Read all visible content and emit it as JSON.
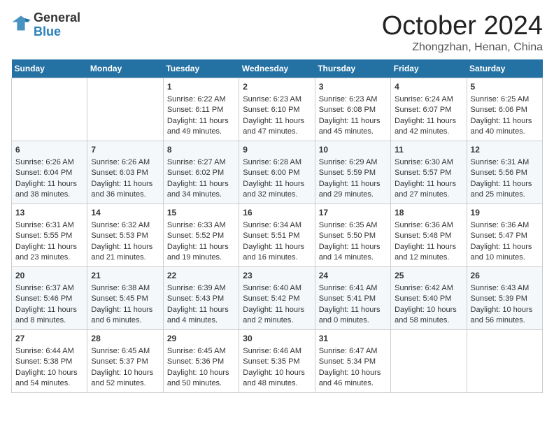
{
  "logo": {
    "line1": "General",
    "line2": "Blue"
  },
  "header": {
    "month": "October 2024",
    "location": "Zhongzhan, Henan, China"
  },
  "days_of_week": [
    "Sunday",
    "Monday",
    "Tuesday",
    "Wednesday",
    "Thursday",
    "Friday",
    "Saturday"
  ],
  "weeks": [
    [
      {
        "day": "",
        "content": ""
      },
      {
        "day": "",
        "content": ""
      },
      {
        "day": "1",
        "content": "Sunrise: 6:22 AM\nSunset: 6:11 PM\nDaylight: 11 hours and 49 minutes."
      },
      {
        "day": "2",
        "content": "Sunrise: 6:23 AM\nSunset: 6:10 PM\nDaylight: 11 hours and 47 minutes."
      },
      {
        "day": "3",
        "content": "Sunrise: 6:23 AM\nSunset: 6:08 PM\nDaylight: 11 hours and 45 minutes."
      },
      {
        "day": "4",
        "content": "Sunrise: 6:24 AM\nSunset: 6:07 PM\nDaylight: 11 hours and 42 minutes."
      },
      {
        "day": "5",
        "content": "Sunrise: 6:25 AM\nSunset: 6:06 PM\nDaylight: 11 hours and 40 minutes."
      }
    ],
    [
      {
        "day": "6",
        "content": "Sunrise: 6:26 AM\nSunset: 6:04 PM\nDaylight: 11 hours and 38 minutes."
      },
      {
        "day": "7",
        "content": "Sunrise: 6:26 AM\nSunset: 6:03 PM\nDaylight: 11 hours and 36 minutes."
      },
      {
        "day": "8",
        "content": "Sunrise: 6:27 AM\nSunset: 6:02 PM\nDaylight: 11 hours and 34 minutes."
      },
      {
        "day": "9",
        "content": "Sunrise: 6:28 AM\nSunset: 6:00 PM\nDaylight: 11 hours and 32 minutes."
      },
      {
        "day": "10",
        "content": "Sunrise: 6:29 AM\nSunset: 5:59 PM\nDaylight: 11 hours and 29 minutes."
      },
      {
        "day": "11",
        "content": "Sunrise: 6:30 AM\nSunset: 5:57 PM\nDaylight: 11 hours and 27 minutes."
      },
      {
        "day": "12",
        "content": "Sunrise: 6:31 AM\nSunset: 5:56 PM\nDaylight: 11 hours and 25 minutes."
      }
    ],
    [
      {
        "day": "13",
        "content": "Sunrise: 6:31 AM\nSunset: 5:55 PM\nDaylight: 11 hours and 23 minutes."
      },
      {
        "day": "14",
        "content": "Sunrise: 6:32 AM\nSunset: 5:53 PM\nDaylight: 11 hours and 21 minutes."
      },
      {
        "day": "15",
        "content": "Sunrise: 6:33 AM\nSunset: 5:52 PM\nDaylight: 11 hours and 19 minutes."
      },
      {
        "day": "16",
        "content": "Sunrise: 6:34 AM\nSunset: 5:51 PM\nDaylight: 11 hours and 16 minutes."
      },
      {
        "day": "17",
        "content": "Sunrise: 6:35 AM\nSunset: 5:50 PM\nDaylight: 11 hours and 14 minutes."
      },
      {
        "day": "18",
        "content": "Sunrise: 6:36 AM\nSunset: 5:48 PM\nDaylight: 11 hours and 12 minutes."
      },
      {
        "day": "19",
        "content": "Sunrise: 6:36 AM\nSunset: 5:47 PM\nDaylight: 11 hours and 10 minutes."
      }
    ],
    [
      {
        "day": "20",
        "content": "Sunrise: 6:37 AM\nSunset: 5:46 PM\nDaylight: 11 hours and 8 minutes."
      },
      {
        "day": "21",
        "content": "Sunrise: 6:38 AM\nSunset: 5:45 PM\nDaylight: 11 hours and 6 minutes."
      },
      {
        "day": "22",
        "content": "Sunrise: 6:39 AM\nSunset: 5:43 PM\nDaylight: 11 hours and 4 minutes."
      },
      {
        "day": "23",
        "content": "Sunrise: 6:40 AM\nSunset: 5:42 PM\nDaylight: 11 hours and 2 minutes."
      },
      {
        "day": "24",
        "content": "Sunrise: 6:41 AM\nSunset: 5:41 PM\nDaylight: 11 hours and 0 minutes."
      },
      {
        "day": "25",
        "content": "Sunrise: 6:42 AM\nSunset: 5:40 PM\nDaylight: 10 hours and 58 minutes."
      },
      {
        "day": "26",
        "content": "Sunrise: 6:43 AM\nSunset: 5:39 PM\nDaylight: 10 hours and 56 minutes."
      }
    ],
    [
      {
        "day": "27",
        "content": "Sunrise: 6:44 AM\nSunset: 5:38 PM\nDaylight: 10 hours and 54 minutes."
      },
      {
        "day": "28",
        "content": "Sunrise: 6:45 AM\nSunset: 5:37 PM\nDaylight: 10 hours and 52 minutes."
      },
      {
        "day": "29",
        "content": "Sunrise: 6:45 AM\nSunset: 5:36 PM\nDaylight: 10 hours and 50 minutes."
      },
      {
        "day": "30",
        "content": "Sunrise: 6:46 AM\nSunset: 5:35 PM\nDaylight: 10 hours and 48 minutes."
      },
      {
        "day": "31",
        "content": "Sunrise: 6:47 AM\nSunset: 5:34 PM\nDaylight: 10 hours and 46 minutes."
      },
      {
        "day": "",
        "content": ""
      },
      {
        "day": "",
        "content": ""
      }
    ]
  ]
}
